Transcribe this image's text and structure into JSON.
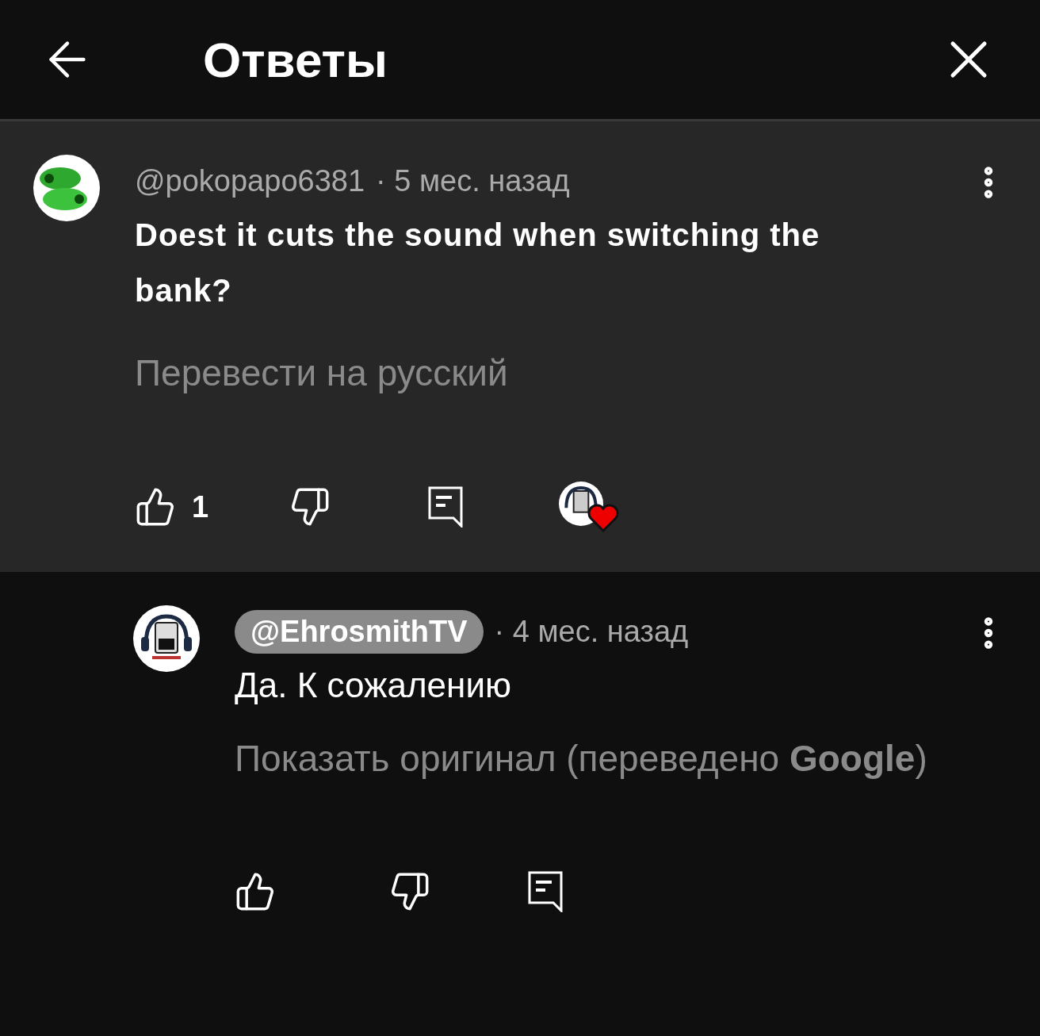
{
  "header": {
    "title": "Ответы"
  },
  "comment": {
    "author": "@pokopapo6381",
    "author_badge": false,
    "time": "· 5 мес. назад",
    "text": "Doest it cuts the sound when switching the bank?",
    "translate_link": "Перевести на русский",
    "likes": "1",
    "hearted": true,
    "highlighted": true,
    "replies": [
      {
        "author": "@EhrosmithTV",
        "author_badge": true,
        "time": "· 4 мес. назад",
        "text": "Да. К сожалению",
        "translate_link": "Показать оригинал (переведено **Google**)",
        "hearted": false,
        "highlighted": false
      }
    ]
  }
}
